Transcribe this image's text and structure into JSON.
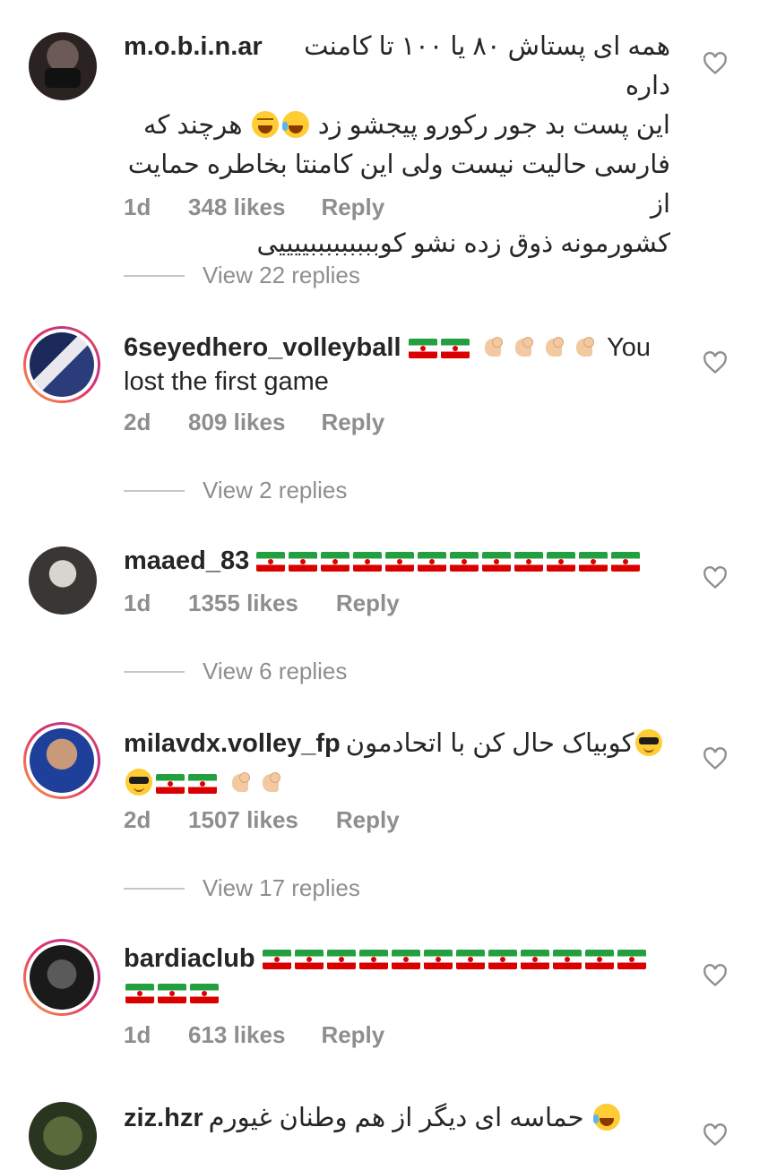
{
  "comments": [
    {
      "username": "m.o.b.i.n.ar",
      "text_lines": [
        "همه ای پستاش ۸۰ یا ۱۰۰ تا کامنت داره",
        "این پست بد جور رکورو پیجشو زد",
        "هرچند که",
        "فارسی حالیت نیست ولی این کامنتا بخاطره حمایت از",
        "کشورمونه ذوق زده نشو کوبببببببببییییی"
      ],
      "emojis": [
        "laughing-face",
        "tears-of-joy-face"
      ],
      "time": "1d",
      "likes": "348 likes",
      "reply": "Reply",
      "view_replies": "View 22 replies"
    },
    {
      "username": "6seyedhero_volleyball",
      "text": "You lost the first game",
      "text_line1": "You",
      "text_line2": "lost the first game",
      "emojis": [
        "iran-flag",
        "iran-flag",
        "flexed-biceps",
        "flexed-biceps",
        "flexed-biceps",
        "flexed-biceps"
      ],
      "time": "2d",
      "likes": "809 likes",
      "reply": "Reply",
      "view_replies": "View 2 replies"
    },
    {
      "username": "maaed_83",
      "emojis": [
        "iran-flag",
        "iran-flag",
        "iran-flag",
        "iran-flag",
        "iran-flag",
        "iran-flag",
        "iran-flag",
        "iran-flag",
        "iran-flag",
        "iran-flag",
        "iran-flag",
        "iran-flag"
      ],
      "time": "1d",
      "likes": "1355 likes",
      "reply": "Reply",
      "view_replies": "View 6 replies"
    },
    {
      "username": "milavdx.volley_fp",
      "text": "کوبیاک حال کن با اتحادمون",
      "emojis": [
        "smiling-face-with-sunglasses",
        "smiling-face-with-sunglasses",
        "iran-flag",
        "iran-flag",
        "flexed-biceps",
        "flexed-biceps"
      ],
      "time": "2d",
      "likes": "1507 likes",
      "reply": "Reply",
      "view_replies": "View 17 replies"
    },
    {
      "username": "bardiaclub",
      "emojis": [
        "iran-flag",
        "iran-flag",
        "iran-flag",
        "iran-flag",
        "iran-flag",
        "iran-flag",
        "iran-flag",
        "iran-flag",
        "iran-flag",
        "iran-flag",
        "iran-flag",
        "iran-flag",
        "iran-flag",
        "iran-flag",
        "iran-flag"
      ],
      "time": "1d",
      "likes": "613 likes",
      "reply": "Reply"
    },
    {
      "username": "ziz.hzr",
      "text": "حماسه ای دیگر از هم وطنان غیورم",
      "emojis": [
        "tears-of-joy-face"
      ]
    }
  ],
  "colors": {
    "text": "#262626",
    "secondary": "#8e8e8e",
    "story_ring": "#e1306c",
    "flag_green": "#239f40",
    "flag_red": "#da0000"
  }
}
